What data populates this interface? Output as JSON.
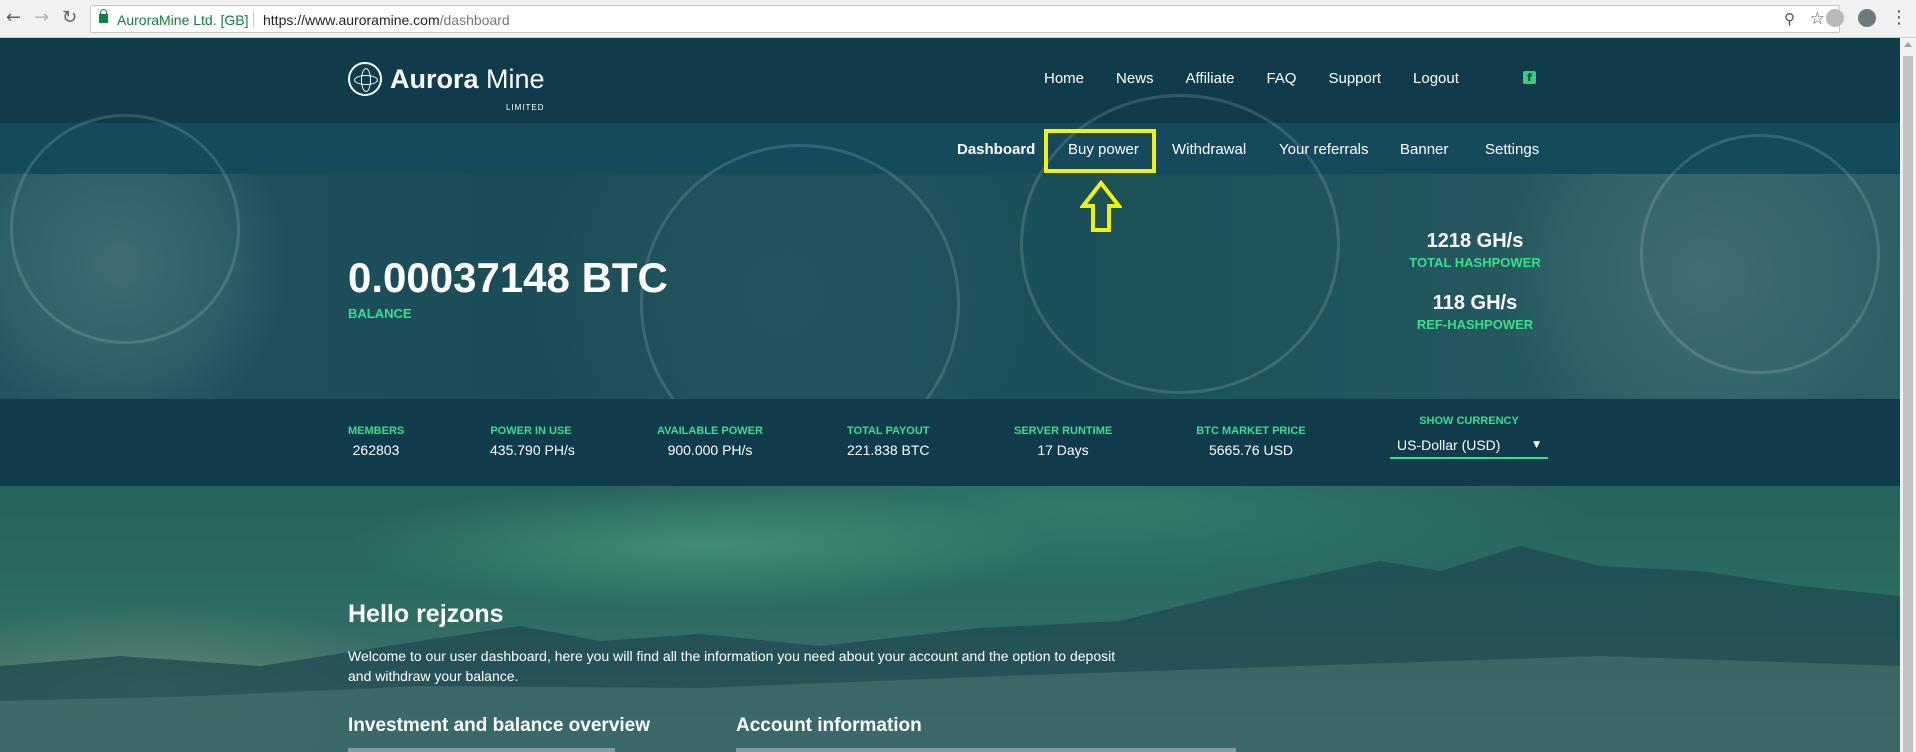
{
  "browser": {
    "secure_label": "AuroraMine Ltd. [GB]",
    "url_host": "https://www.auroramine.com",
    "url_path": "/dashboard"
  },
  "site": {
    "brand_bold": "Aurora",
    "brand_light": "Mine",
    "brand_sub": "LIMITED",
    "main_nav": [
      "Home",
      "News",
      "Affiliate",
      "FAQ",
      "Support",
      "Logout"
    ],
    "sub_nav": {
      "dashboard": "Dashboard",
      "buy_power": "Buy power",
      "withdrawal": "Withdrawal",
      "referrals": "Your referrals",
      "banner": "Banner",
      "settings": "Settings"
    }
  },
  "hero": {
    "balance_value": "0.00037148 BTC",
    "balance_label": "BALANCE",
    "total_hashpower_value": "1218 GH/s",
    "total_hashpower_label": "TOTAL HASHPOWER",
    "ref_hashpower_value": "118 GH/s",
    "ref_hashpower_label": "REF-HASHPOWER"
  },
  "stats": {
    "members": {
      "label": "MEMBERS",
      "value": "262803"
    },
    "power_in_use": {
      "label": "POWER IN USE",
      "value": "435.790 PH/s"
    },
    "available_power": {
      "label": "AVAILABLE POWER",
      "value": "900.000 PH/s"
    },
    "total_payout": {
      "label": "TOTAL PAYOUT",
      "value": "221.838 BTC"
    },
    "server_runtime": {
      "label": "SERVER RUNTIME",
      "value": "17 Days"
    },
    "btc_market_price": {
      "label": "BTC MARKET PRICE",
      "value": "5665.76 USD"
    },
    "currency_label": "SHOW CURRENCY",
    "currency_selected": "US-Dollar (USD)"
  },
  "content": {
    "greeting": "Hello rejzons",
    "welcome_text": "Welcome to our user dashboard, here you will find all the information you need about your account and the option to deposit and withdraw your balance.",
    "investment_heading": "Investment and balance overview",
    "account_heading": "Account information"
  },
  "colors": {
    "accent_green": "#35e08a",
    "highlight_yellow": "#f3f30a",
    "nav_bg": "#0f3b4b"
  }
}
